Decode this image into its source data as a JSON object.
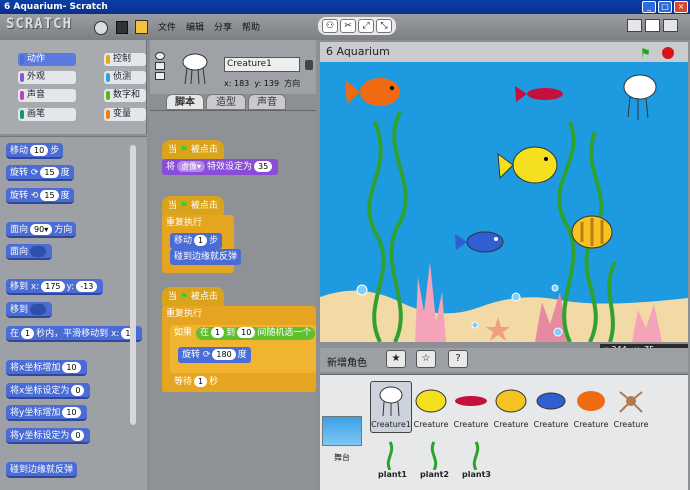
{
  "window": {
    "title": "6 Aquarium- Scratch"
  },
  "app": {
    "logo": "SCRATCH"
  },
  "menu": {
    "file": "文件",
    "edit": "编辑",
    "share": "分享",
    "help": "帮助"
  },
  "categories": [
    "动作",
    "控制",
    "外观",
    "侦测",
    "声音",
    "数字和",
    "画笔",
    "变量"
  ],
  "category_colors": {
    "motion": "#4a6cd4",
    "control": "#e1a91a",
    "looks": "#8a55d7",
    "sensing": "#2ca5e2",
    "sound": "#bb42c3",
    "operators": "#5cb712",
    "pen": "#0e9a6c",
    "variables": "#ee7d16"
  },
  "palette": {
    "move": {
      "a": "移动",
      "v": "10",
      "b": "步"
    },
    "turn_cw": {
      "a": "旋转",
      "v": "15",
      "b": "度"
    },
    "turn_ccw": {
      "a": "旋转",
      "v": "15",
      "b": "度"
    },
    "point_dir": {
      "a": "面向",
      "v": "90▾",
      "b": "方向"
    },
    "point_towards": {
      "a": "面向"
    },
    "goto_xy": {
      "a": "移到 x:",
      "x": "175",
      "b": "y:",
      "y": "-13"
    },
    "goto": {
      "a": "移到"
    },
    "glide": {
      "a": "在",
      "v": "1",
      "b": "秒内，平滑移动到 x:",
      "x": "1"
    },
    "change_x": {
      "a": "将x坐标增加",
      "v": "10"
    },
    "set_x": {
      "a": "将x坐标设定为",
      "v": "0"
    },
    "change_y": {
      "a": "将y坐标增加",
      "v": "10"
    },
    "set_y": {
      "a": "将y坐标设定为",
      "v": "0"
    },
    "bounce": "碰到边缘就反弹"
  },
  "sprite": {
    "name": "Creature1",
    "x_label": "x:",
    "x": "183",
    "y_label": "y:",
    "y": "139",
    "dir_label": "方向"
  },
  "tabs": [
    "脚本",
    "造型",
    "声音"
  ],
  "scripts": {
    "hat": "当",
    "hat2": "被点击",
    "s1_set_a": "将",
    "s1_effect": "虚像▾",
    "s1_set_b": "特效设定为",
    "s1_val": "35",
    "forever": "重复执行",
    "move_a": "移动",
    "move_v": "1",
    "move_b": "步",
    "bounce": "碰到边缘就反弹",
    "if": "如果",
    "pick_a": "在",
    "pick_lo": "1",
    "pick_mid": "到",
    "pick_hi": "10",
    "pick_b": "间随机选一个",
    "turn_a": "旋转",
    "turn_v": "180",
    "turn_b": "度",
    "wait_a": "等待",
    "wait_v": "1",
    "wait_b": "秒"
  },
  "stage": {
    "title": "6 Aquarium",
    "readout_x_label": "x:",
    "readout_x": "244",
    "readout_y_label": "y:",
    "readout_y": "-75"
  },
  "new_sprite_label": "新增角色",
  "stage_label": "舞台",
  "sprites": [
    "Creature1",
    "Creature",
    "Creature",
    "Creature",
    "Creature",
    "Creature",
    "Creature"
  ],
  "plants": [
    "plant1",
    "plant2",
    "plant3"
  ]
}
